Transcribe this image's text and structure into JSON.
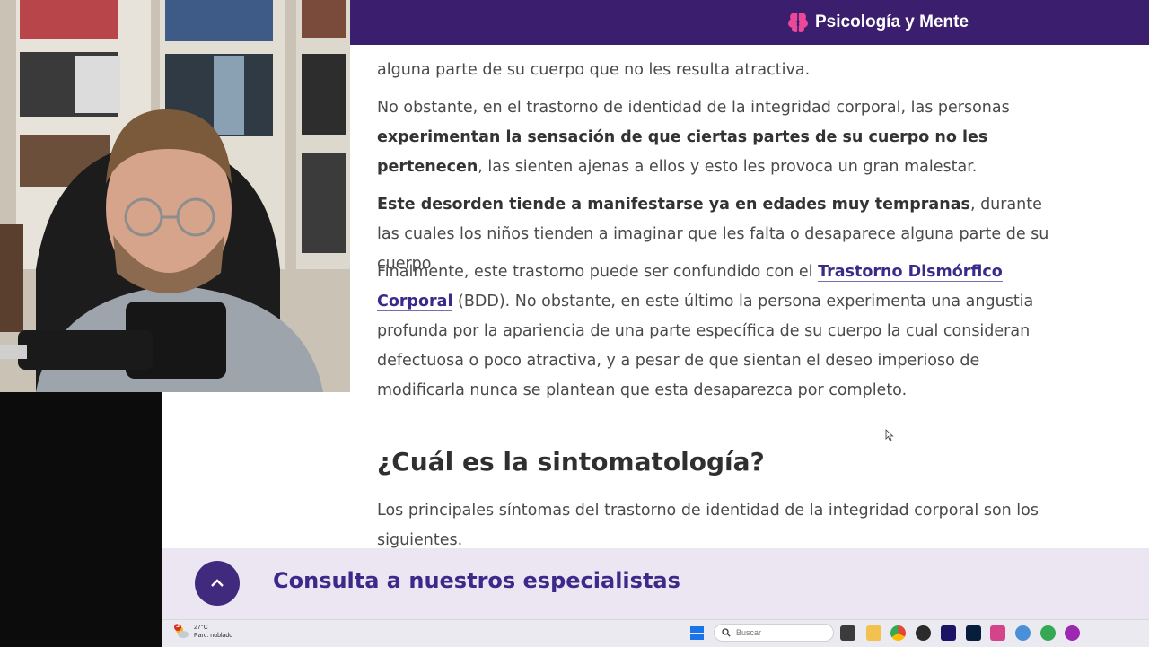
{
  "header": {
    "brand": "Psicología y Mente"
  },
  "article": {
    "p0_tail": "alguna parte de su cuerpo que no les resulta atractiva.",
    "p1": {
      "a": "No obstante, en el trastorno de identidad de la integridad corporal, las personas ",
      "b": "experimentan la sensación de que ciertas partes de su cuerpo no les pertenecen",
      "c": ", las sienten ajenas a ellos y esto les provoca un gran malestar."
    },
    "p2": {
      "b": "Este desorden tiende a manifestarse ya en edades muy tempranas",
      "c": ", durante las cuales los niños tienden a imaginar que les falta o desaparece alguna parte de su cuerpo."
    },
    "p3": {
      "a": "Finalmente, este trastorno puede ser confundido con el ",
      "link": "Trastorno Dismórfico Corporal",
      "c": " (BDD). No obstante, en este último la persona experimenta una angustia profunda por la apariencia de una parte específica de su cuerpo la cual consideran defectuosa o poco atractiva, y a pesar de que sientan el deseo imperioso de modificarla nunca se plantean que esta desaparezca por completo."
    },
    "heading": "¿Cuál es la sintomatología?",
    "p4": "Los principales síntomas del trastorno de identidad de la integridad corporal son los siguientes."
  },
  "consult": {
    "label": "Consulta a nuestros especialistas"
  },
  "taskbar": {
    "weather_badge": "3",
    "temperature": "27°C",
    "condition": "Parc. nublado",
    "search_placeholder": "Buscar"
  },
  "colors": {
    "brand": "#3b1f6e",
    "accent": "#3f2a7e",
    "banner": "#ece6f3"
  }
}
